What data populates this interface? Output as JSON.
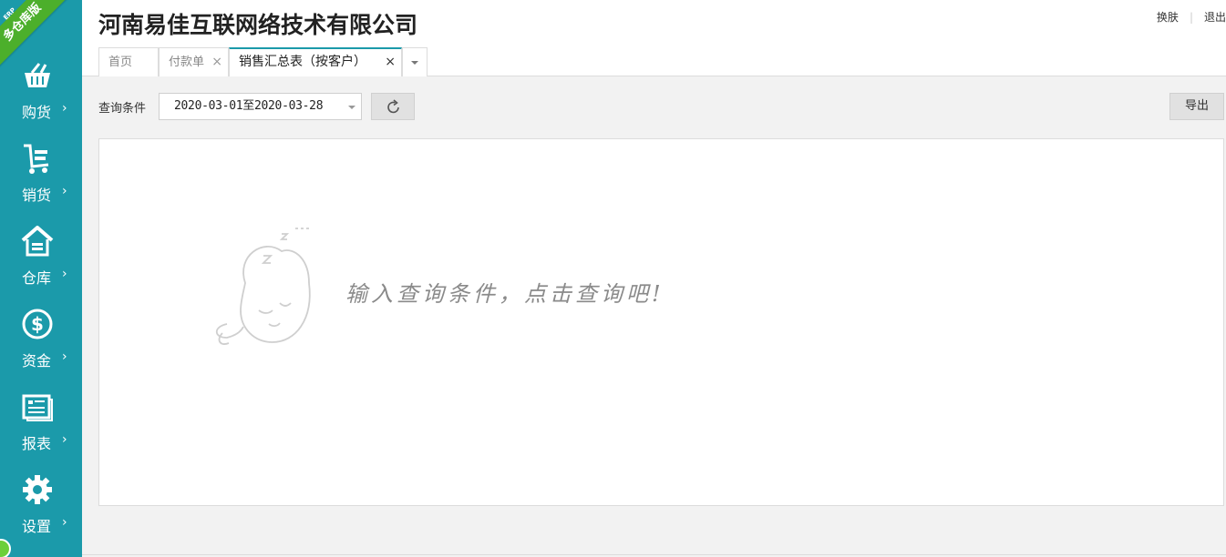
{
  "sidebar": {
    "ribbon": {
      "main": "多仓库版",
      "small": "ERP"
    },
    "items": [
      {
        "label": "购货",
        "icon": "basket-icon"
      },
      {
        "label": "销货",
        "icon": "cart-icon"
      },
      {
        "label": "仓库",
        "icon": "warehouse-icon"
      },
      {
        "label": "资金",
        "icon": "dollar-icon"
      },
      {
        "label": "报表",
        "icon": "report-icon"
      },
      {
        "label": "设置",
        "icon": "gear-icon"
      }
    ]
  },
  "header": {
    "company": "河南易佳互联网络技术有限公司",
    "links": {
      "skin": "换肤",
      "logout": "退出"
    }
  },
  "tabs": [
    {
      "label": "首页"
    },
    {
      "label": "付款单"
    },
    {
      "label": "销售汇总表（按客户）",
      "active": true
    }
  ],
  "toolbar": {
    "query_label": "查询条件",
    "date_range": "2020-03-01至2020-03-28",
    "export_label": "导出"
  },
  "empty_state": {
    "message": "输入查询条件，点击查询吧!"
  },
  "colors": {
    "sidebar": "#1b9aaa",
    "ribbon": "#4caf2b",
    "accent": "#1b9aaa"
  }
}
